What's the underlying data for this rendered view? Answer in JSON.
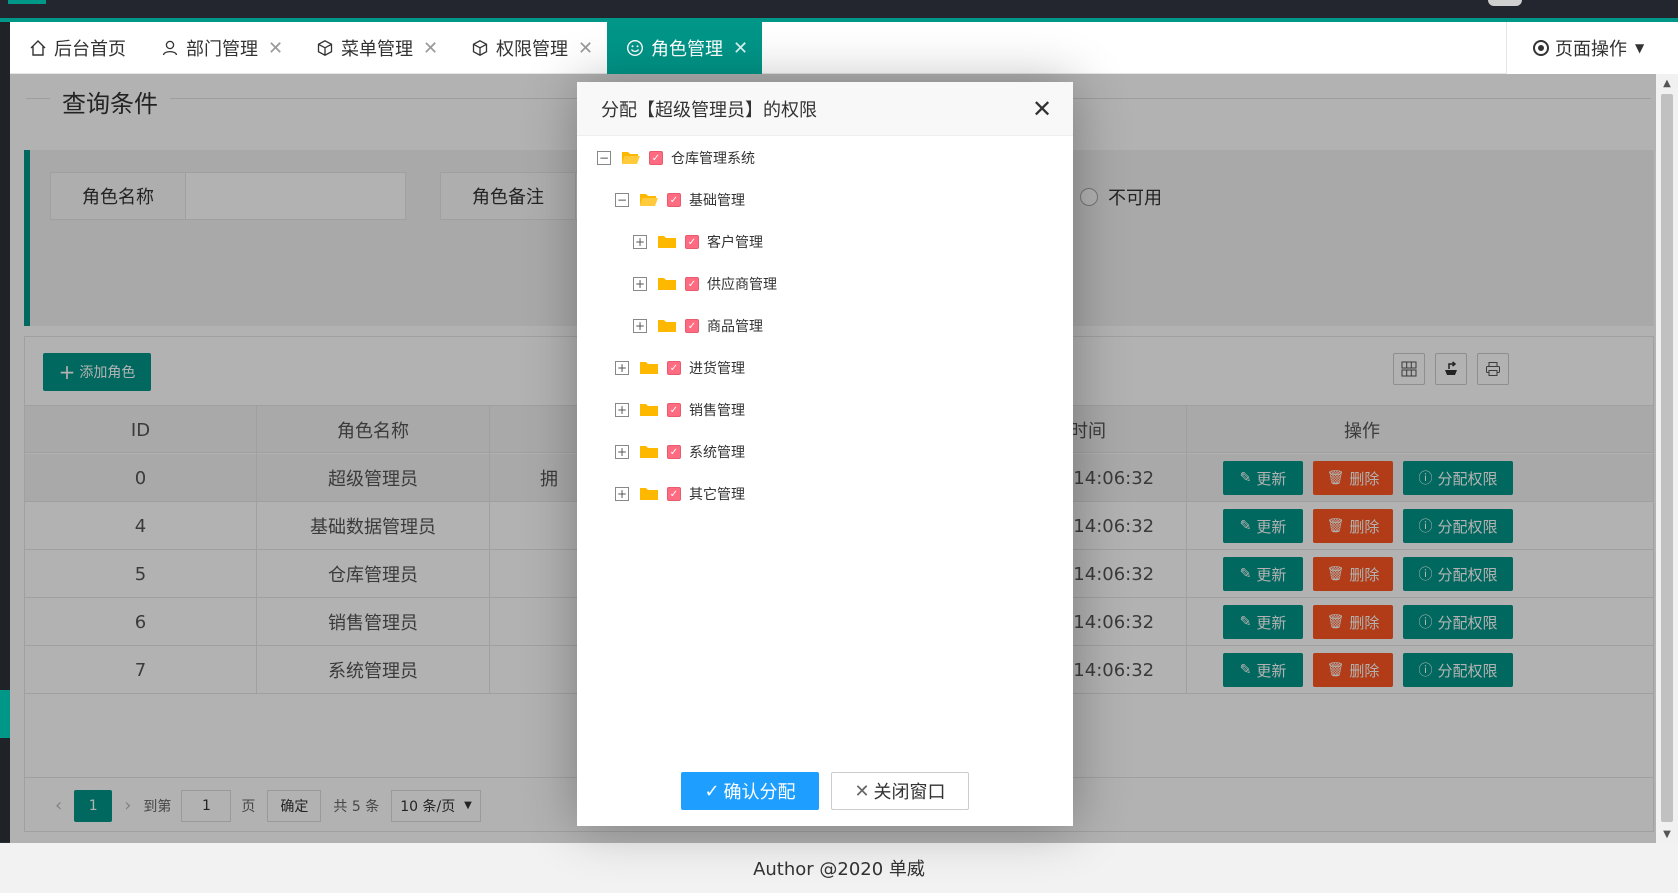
{
  "tabs": [
    {
      "label": "后台首页",
      "icon": "home-icon",
      "closable": false,
      "active": false
    },
    {
      "label": "部门管理",
      "icon": "user-icon",
      "closable": true,
      "active": false
    },
    {
      "label": "菜单管理",
      "icon": "cube-icon",
      "closable": true,
      "active": false
    },
    {
      "label": "权限管理",
      "icon": "cube-icon",
      "closable": true,
      "active": false
    },
    {
      "label": "角色管理",
      "icon": "smile-icon",
      "closable": true,
      "active": true
    }
  ],
  "page_ops": "页面操作",
  "query": {
    "legend": "查询条件",
    "role_name_label": "角色名称",
    "role_name_value": "",
    "remark_label": "角色备注",
    "unavailable_label": "不可用"
  },
  "toolbar": {
    "add_label": "添加角色",
    "icons": [
      "columns-icon",
      "export-icon",
      "print-icon"
    ]
  },
  "table": {
    "headers": [
      "ID",
      "角色名称",
      "",
      "创建时间",
      "操作"
    ],
    "rows": [
      {
        "id": "0",
        "name": "超级管理员",
        "remark": "拥",
        "created": "19-04-10 14:06:32"
      },
      {
        "id": "4",
        "name": "基础数据管理员",
        "remark": "",
        "created": "19-04-10 14:06:32"
      },
      {
        "id": "5",
        "name": "仓库管理员",
        "remark": "",
        "created": "19-04-10 14:06:32"
      },
      {
        "id": "6",
        "name": "销售管理员",
        "remark": "",
        "created": "19-04-10 14:06:32"
      },
      {
        "id": "7",
        "name": "系统管理员",
        "remark": "",
        "created": "19-04-10 14:06:32"
      }
    ],
    "actions": {
      "update": "更新",
      "delete": "删除",
      "assign": "分配权限"
    }
  },
  "pager": {
    "current": "1",
    "goto_label": "到第",
    "goto_value": "1",
    "page_unit": "页",
    "confirm": "确定",
    "total": "共 5 条",
    "page_size": "10 条/页"
  },
  "modal": {
    "title": "分配【超级管理员】的权限",
    "tree": [
      {
        "label": "仓库管理系统",
        "level": 0,
        "expanded": true,
        "checked": true
      },
      {
        "label": "基础管理",
        "level": 1,
        "expanded": true,
        "checked": true
      },
      {
        "label": "客户管理",
        "level": 2,
        "expanded": false,
        "checked": true
      },
      {
        "label": "供应商管理",
        "level": 2,
        "expanded": false,
        "checked": true
      },
      {
        "label": "商品管理",
        "level": 2,
        "expanded": false,
        "checked": true
      },
      {
        "label": "进货管理",
        "level": 1,
        "expanded": false,
        "checked": true
      },
      {
        "label": "销售管理",
        "level": 1,
        "expanded": false,
        "checked": true
      },
      {
        "label": "系统管理",
        "level": 1,
        "expanded": false,
        "checked": true
      },
      {
        "label": "其它管理",
        "level": 1,
        "expanded": false,
        "checked": true
      }
    ],
    "confirm_label": "确认分配",
    "close_label": "关闭窗口"
  },
  "footer": "Author @2020 单威",
  "colors": {
    "primary": "#009688",
    "danger": "#ff5722",
    "blue": "#1e9fff",
    "checkbox": "#ff6b81",
    "folder": "#ffb800"
  }
}
